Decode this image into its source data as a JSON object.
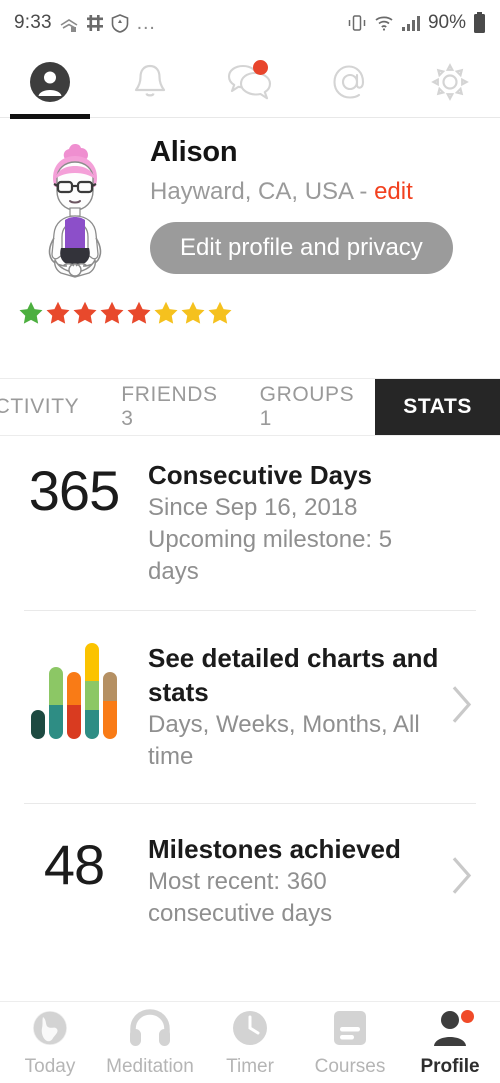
{
  "statusbar": {
    "time": "9:33",
    "battery": "90%",
    "overflow": "…",
    "icons": [
      "data-saver-icon",
      "slack-icon",
      "brave-shield-icon",
      "vibrate-icon",
      "wifi-icon",
      "signal-icon",
      "battery-icon"
    ]
  },
  "topnav": {
    "items": [
      {
        "name": "profile",
        "icon": "person-circle-icon",
        "active": true,
        "badge": false
      },
      {
        "name": "notifications",
        "icon": "bell-icon",
        "active": false,
        "badge": false
      },
      {
        "name": "messages",
        "icon": "chat-bubbles-icon",
        "active": false,
        "badge": true
      },
      {
        "name": "mentions",
        "icon": "at-sign-icon",
        "active": false,
        "badge": false
      },
      {
        "name": "settings",
        "icon": "gear-icon",
        "active": false,
        "badge": false
      }
    ]
  },
  "profile": {
    "avatar_alt": "meditating-avatar",
    "name": "Alison",
    "location": "Hayward, CA, USA - ",
    "edit_link": "edit",
    "button_label": "Edit profile and privacy",
    "stars": [
      "#4caf3f",
      "#e8492c",
      "#e8492c",
      "#e8492c",
      "#e8492c",
      "#f5c11e",
      "#f5c11e",
      "#f5c11e"
    ]
  },
  "tabs": [
    {
      "label": "ACTIVITY",
      "active": false
    },
    {
      "label": "FRIENDS 3",
      "active": false
    },
    {
      "label": "GROUPS 1",
      "active": false
    },
    {
      "label": "STATS",
      "active": true
    }
  ],
  "stats": [
    {
      "figure_type": "number",
      "number": "365",
      "title": "Consecutive Days",
      "sub1": "Since Sep 16, 2018",
      "sub2": "Upcoming milestone: 5 days",
      "chevron": false
    },
    {
      "figure_type": "chart",
      "number": "",
      "title": "See detailed charts and stats",
      "sub1": "Days, Weeks, Months, All time",
      "sub2": "",
      "chevron": true
    },
    {
      "figure_type": "number",
      "number": "48",
      "title": "Milestones achieved",
      "sub1": "Most recent: 360 consecutive days",
      "sub2": "",
      "chevron": true
    }
  ],
  "chart_data": {
    "type": "bar",
    "title": "mini stacked bar chart icon",
    "categories": [
      "1",
      "2",
      "3",
      "4",
      "5"
    ],
    "stacked": true,
    "series": [
      {
        "name": "base",
        "color": "#1d4a41",
        "values": [
          34,
          0,
          0,
          0,
          0
        ]
      },
      {
        "name": "teal",
        "color": "#2e8d84",
        "values": [
          0,
          40,
          0,
          34,
          0
        ]
      },
      {
        "name": "red",
        "color": "#d93b20",
        "values": [
          0,
          0,
          40,
          0,
          0
        ]
      },
      {
        "name": "green",
        "color": "#8cc765",
        "values": [
          0,
          44,
          0,
          34,
          0
        ]
      },
      {
        "name": "orange",
        "color": "#f97b16",
        "values": [
          0,
          0,
          38,
          0,
          44
        ]
      },
      {
        "name": "yellow",
        "color": "#fbc300",
        "values": [
          0,
          0,
          0,
          44,
          0
        ]
      },
      {
        "name": "tan",
        "color": "#b59063",
        "values": [
          0,
          0,
          0,
          0,
          34
        ]
      }
    ],
    "xlabel": "",
    "ylabel": "",
    "ylim": [
      0,
      112
    ],
    "grid": false,
    "legend": "none"
  },
  "bottomnav": [
    {
      "label": "Today",
      "icon": "globe-icon",
      "active": false,
      "badge": false
    },
    {
      "label": "Meditation",
      "icon": "headphones-icon",
      "active": false,
      "badge": false
    },
    {
      "label": "Timer",
      "icon": "clock-icon",
      "active": false,
      "badge": false
    },
    {
      "label": "Courses",
      "icon": "card-list-icon",
      "active": false,
      "badge": false
    },
    {
      "label": "Profile",
      "icon": "person-icon",
      "active": true,
      "badge": true
    }
  ],
  "colors": {
    "accent_red": "#f2411f",
    "badge_red": "#e8452c",
    "active_tab_bg": "#262626",
    "muted_text": "#9a9a9a",
    "button_gray": "#9b9b9b"
  }
}
